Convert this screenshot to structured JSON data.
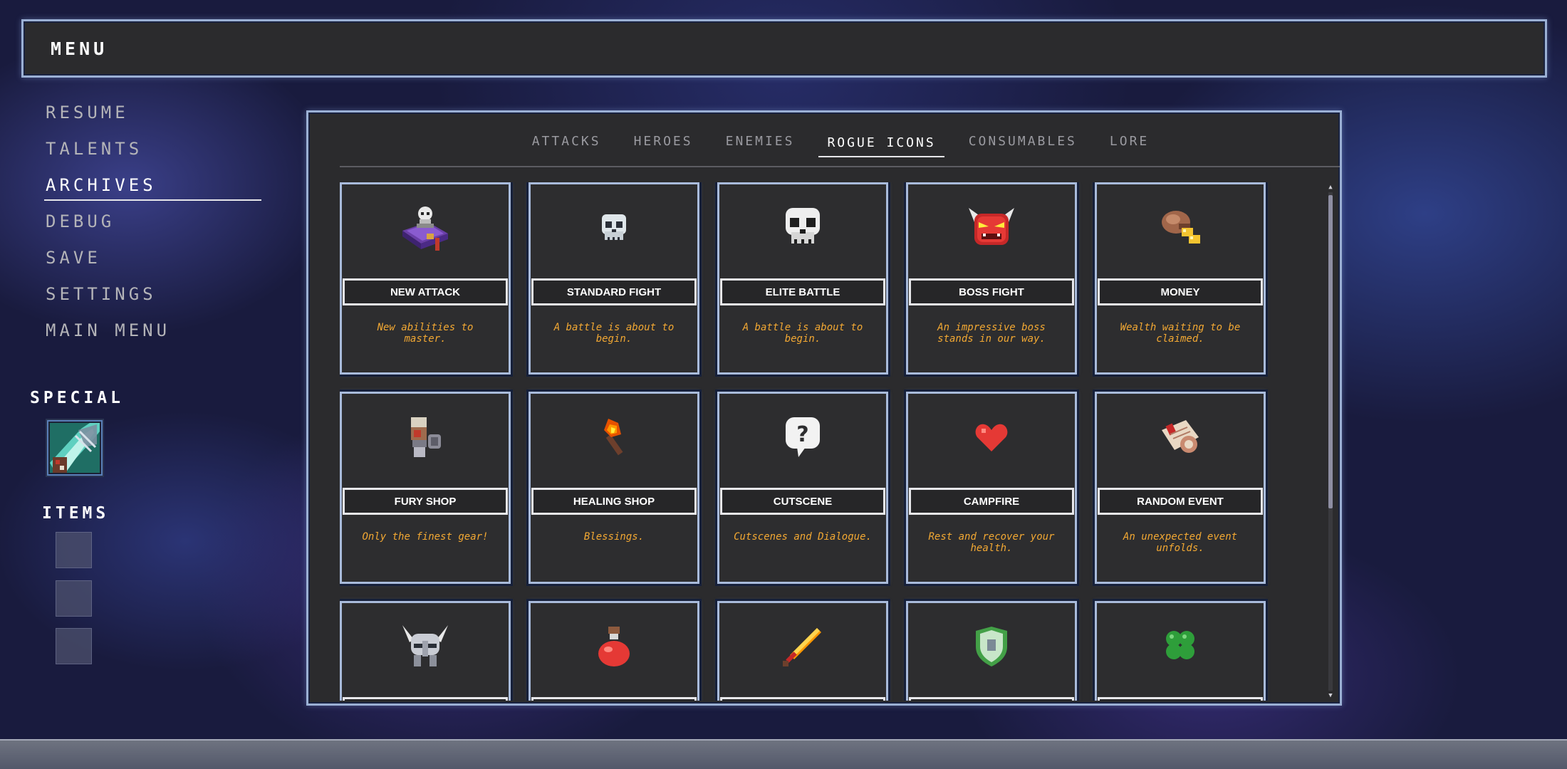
{
  "header": {
    "title": "MENU"
  },
  "nav": {
    "items": [
      {
        "label": "RESUME",
        "active": false
      },
      {
        "label": "TALENTS",
        "active": false
      },
      {
        "label": "ARCHIVES",
        "active": true
      },
      {
        "label": "DEBUG",
        "active": false
      },
      {
        "label": "SAVE",
        "active": false
      },
      {
        "label": "SETTINGS",
        "active": false
      },
      {
        "label": "MAIN MENU",
        "active": false
      }
    ]
  },
  "special": {
    "label": "SPECIAL",
    "icon": "sword-slash-icon"
  },
  "items_section": {
    "label": "ITEMS",
    "slot_count": 3
  },
  "archives": {
    "tabs": [
      {
        "label": "ATTACKS",
        "active": false
      },
      {
        "label": "HEROES",
        "active": false
      },
      {
        "label": "ENEMIES",
        "active": false
      },
      {
        "label": "ROGUE ICONS",
        "active": true
      },
      {
        "label": "CONSUMABLES",
        "active": false
      },
      {
        "label": "LORE",
        "active": false
      }
    ],
    "cards": [
      {
        "title": "NEW ATTACK",
        "desc": "New abilities to master.",
        "icon": "spellbook-skull-icon"
      },
      {
        "title": "STANDARD FIGHT",
        "desc": "A battle is about to begin.",
        "icon": "small-skull-icon"
      },
      {
        "title": "ELITE BATTLE",
        "desc": "A battle is about to begin.",
        "icon": "skull-icon"
      },
      {
        "title": "BOSS FIGHT",
        "desc": "An impressive boss stands in our way.",
        "icon": "demon-mask-icon"
      },
      {
        "title": "MONEY",
        "desc": "Wealth waiting to be claimed.",
        "icon": "coin-pouch-icon"
      },
      {
        "title": "FURY SHOP",
        "desc": "Only the finest gear!",
        "icon": "shop-armor-icon"
      },
      {
        "title": "HEALING SHOP",
        "desc": "Blessings.",
        "icon": "torch-icon"
      },
      {
        "title": "CUTSCENE",
        "desc": "Cutscenes and Dialogue.",
        "icon": "question-bubble-icon"
      },
      {
        "title": "CAMPFIRE",
        "desc": "Rest and recover your health.",
        "icon": "heart-icon"
      },
      {
        "title": "RANDOM EVENT",
        "desc": "An unexpected event unfolds.",
        "icon": "scroll-icon"
      },
      {
        "title": "",
        "desc": "",
        "icon": "horned-helmet-icon"
      },
      {
        "title": "",
        "desc": "",
        "icon": "red-potion-icon"
      },
      {
        "title": "",
        "desc": "",
        "icon": "flame-sword-icon"
      },
      {
        "title": "",
        "desc": "",
        "icon": "shield-icon"
      },
      {
        "title": "",
        "desc": "",
        "icon": "clover-icon"
      }
    ]
  },
  "colors": {
    "accent_border": "#9bb0d4",
    "description_text": "#f2a833",
    "panel_bg": "#2b2b2d"
  }
}
